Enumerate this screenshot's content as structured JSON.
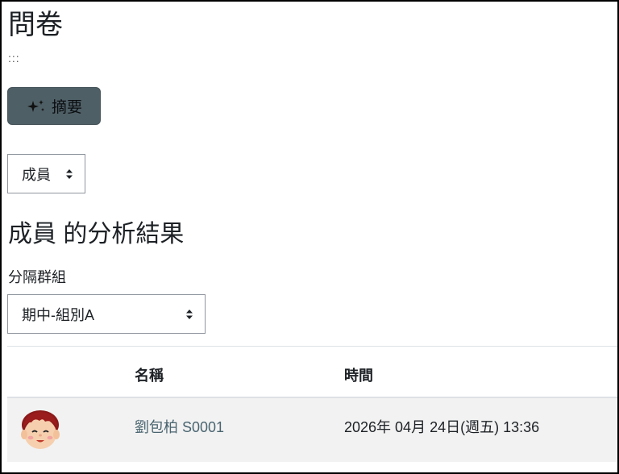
{
  "page": {
    "title": "問卷",
    "dots": ":::"
  },
  "toolbar": {
    "summary_label": "摘要",
    "summary_icon": "sparkles-icon"
  },
  "view_select": {
    "selected": "成員"
  },
  "section": {
    "title": "成員 的分析結果"
  },
  "group_select": {
    "label": "分隔群組",
    "selected": "期中-組別A"
  },
  "table": {
    "columns": [
      "名稱",
      "時間"
    ],
    "rows": [
      {
        "avatar": "user-avatar-icon",
        "name": "劉包柏 S0001",
        "time": "2026年 04月 24日(週五) 13:36"
      }
    ]
  },
  "colors": {
    "button_bg": "#4f5f66",
    "link": "#4a6570",
    "row_bg": "#f2f2f2"
  }
}
